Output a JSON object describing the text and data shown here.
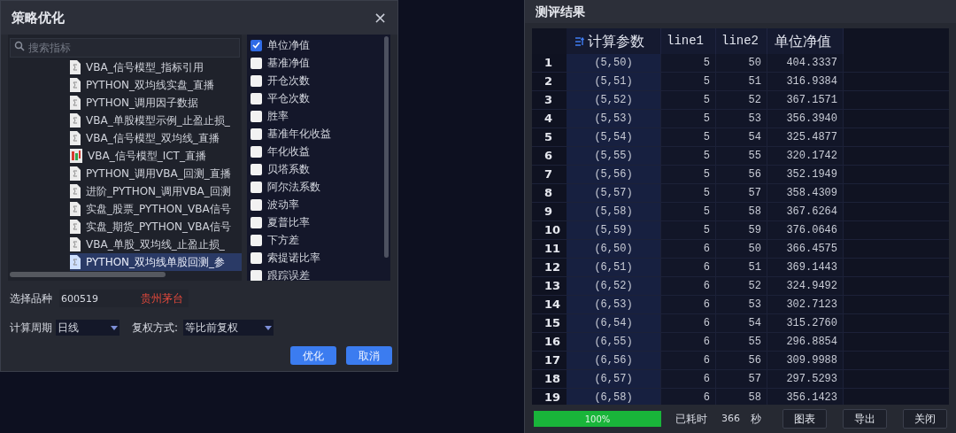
{
  "optimize_dialog": {
    "title": "策略优化",
    "close": "×",
    "search": {
      "placeholder": "搜索指标"
    },
    "strategies": [
      {
        "label": "VBA_信号模型_指标引用",
        "kind": "formula",
        "selected": false
      },
      {
        "label": "PYTHON_双均线实盘_直播",
        "kind": "formula",
        "selected": false
      },
      {
        "label": "PYTHON_调用因子数据",
        "kind": "formula",
        "selected": false
      },
      {
        "label": "VBA_单股模型示例_止盈止损_",
        "kind": "formula",
        "selected": false
      },
      {
        "label": "VBA_信号模型_双均线_直播",
        "kind": "formula",
        "selected": false
      },
      {
        "label": "VBA_信号模型_ICT_直播",
        "kind": "chart",
        "selected": false
      },
      {
        "label": "PYTHON_调用VBA_回测_直播",
        "kind": "formula",
        "selected": false
      },
      {
        "label": "进阶_PYTHON_调用VBA_回测",
        "kind": "formula",
        "selected": false
      },
      {
        "label": "实盘_股票_PYTHON_VBA信号",
        "kind": "formula",
        "selected": false
      },
      {
        "label": "实盘_期货_PYTHON_VBA信号",
        "kind": "formula",
        "selected": false
      },
      {
        "label": "VBA_单股_双均线_止盈止损_",
        "kind": "formula",
        "selected": false
      },
      {
        "label": "PYTHON_双均线单股回测_参",
        "kind": "formula",
        "selected": true
      }
    ],
    "metrics": [
      {
        "label": "单位净值",
        "checked": true
      },
      {
        "label": "基准净值",
        "checked": false
      },
      {
        "label": "开仓次数",
        "checked": false
      },
      {
        "label": "平仓次数",
        "checked": false
      },
      {
        "label": "胜率",
        "checked": false
      },
      {
        "label": "基准年化收益",
        "checked": false
      },
      {
        "label": "年化收益",
        "checked": false
      },
      {
        "label": "贝塔系数",
        "checked": false
      },
      {
        "label": "阿尔法系数",
        "checked": false
      },
      {
        "label": "波动率",
        "checked": false
      },
      {
        "label": "夏普比率",
        "checked": false
      },
      {
        "label": "下方差",
        "checked": false
      },
      {
        "label": "索提诺比率",
        "checked": false
      },
      {
        "label": "跟踪误差",
        "checked": false
      }
    ],
    "symbol": {
      "label": "选择品种",
      "value": "600519",
      "name": "贵州茅台"
    },
    "period": {
      "label": "计算周期",
      "value": "日线"
    },
    "adjust": {
      "label": "复权方式:",
      "value": "等比前复权"
    },
    "buttons": [
      "优化",
      "取消"
    ]
  },
  "results_dialog": {
    "title": "测评结果",
    "table": {
      "columns": [
        "计算参数",
        "line1",
        "line2",
        "单位净值"
      ],
      "rows": [
        {
          "index": "1",
          "cells": [
            "(5,50)",
            "5",
            "50",
            "404.3337"
          ]
        },
        {
          "index": "2",
          "cells": [
            "(5,51)",
            "5",
            "51",
            "316.9384"
          ]
        },
        {
          "index": "3",
          "cells": [
            "(5,52)",
            "5",
            "52",
            "367.1571"
          ]
        },
        {
          "index": "4",
          "cells": [
            "(5,53)",
            "5",
            "53",
            "356.3940"
          ]
        },
        {
          "index": "5",
          "cells": [
            "(5,54)",
            "5",
            "54",
            "325.4877"
          ]
        },
        {
          "index": "6",
          "cells": [
            "(5,55)",
            "5",
            "55",
            "320.1742"
          ]
        },
        {
          "index": "7",
          "cells": [
            "(5,56)",
            "5",
            "56",
            "352.1949"
          ]
        },
        {
          "index": "8",
          "cells": [
            "(5,57)",
            "5",
            "57",
            "358.4309"
          ]
        },
        {
          "index": "9",
          "cells": [
            "(5,58)",
            "5",
            "58",
            "367.6264"
          ]
        },
        {
          "index": "10",
          "cells": [
            "(5,59)",
            "5",
            "59",
            "376.0646"
          ]
        },
        {
          "index": "11",
          "cells": [
            "(6,50)",
            "6",
            "50",
            "366.4575"
          ]
        },
        {
          "index": "12",
          "cells": [
            "(6,51)",
            "6",
            "51",
            "369.1443"
          ]
        },
        {
          "index": "13",
          "cells": [
            "(6,52)",
            "6",
            "52",
            "324.9492"
          ]
        },
        {
          "index": "14",
          "cells": [
            "(6,53)",
            "6",
            "53",
            "302.7123"
          ]
        },
        {
          "index": "15",
          "cells": [
            "(6,54)",
            "6",
            "54",
            "315.2760"
          ]
        },
        {
          "index": "16",
          "cells": [
            "(6,55)",
            "6",
            "55",
            "296.8854"
          ]
        },
        {
          "index": "17",
          "cells": [
            "(6,56)",
            "6",
            "56",
            "309.9988"
          ]
        },
        {
          "index": "18",
          "cells": [
            "(6,57)",
            "6",
            "57",
            "297.5293"
          ]
        },
        {
          "index": "19",
          "cells": [
            "(6,58)",
            "6",
            "58",
            "356.1423"
          ]
        }
      ]
    },
    "progress": {
      "level": 1,
      "text": "100%"
    },
    "elapsed_label": "已耗时",
    "elapsed": "366",
    "elapsed_unit": "秒",
    "buttons": [
      "图表",
      "导出",
      "关闭"
    ]
  }
}
